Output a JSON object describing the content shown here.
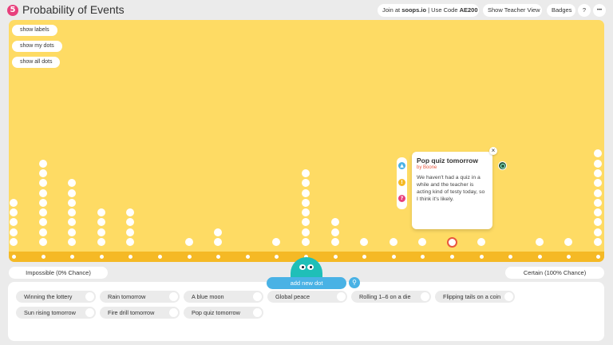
{
  "header": {
    "logo": "5",
    "title": "Probability of Events",
    "join_prefix": "Join at ",
    "join_site": "soops.io",
    "join_mid": " | Use Code ",
    "join_code": "AE200",
    "teacher_view": "Show Teacher View",
    "badges": "Badges",
    "help": "?",
    "more": "•••"
  },
  "controls": {
    "show_labels": "show labels",
    "show_my_dots": "show my dots",
    "show_all_dots": "show all dots"
  },
  "scale": {
    "left_label": "Impossible (0% Chance)",
    "right_label": "Certain (100% Chance)"
  },
  "popup": {
    "title": "Pop quiz tomorrow",
    "author": "by Boone",
    "body": "We haven't had a quiz in a while and the teacher is acting kind of testy today, so I think it's likely.",
    "close": "×"
  },
  "add_dot": "add new dot",
  "events": [
    "Winning the lottery",
    "Rain tomorrow",
    "A blue moon",
    "Global peace",
    "Rolling 1–6 on a die",
    "Flipping tails on a coin",
    "Sun rising tomorrow",
    "Fire drill tomorrow",
    "Pop quiz tomorrow"
  ],
  "colors": {
    "board": "#fedb64",
    "strip": "#f5b925",
    "accent_blue": "#49b2e5",
    "mascot": "#1fbfb8",
    "selected_ring": "#e8573f"
  }
}
